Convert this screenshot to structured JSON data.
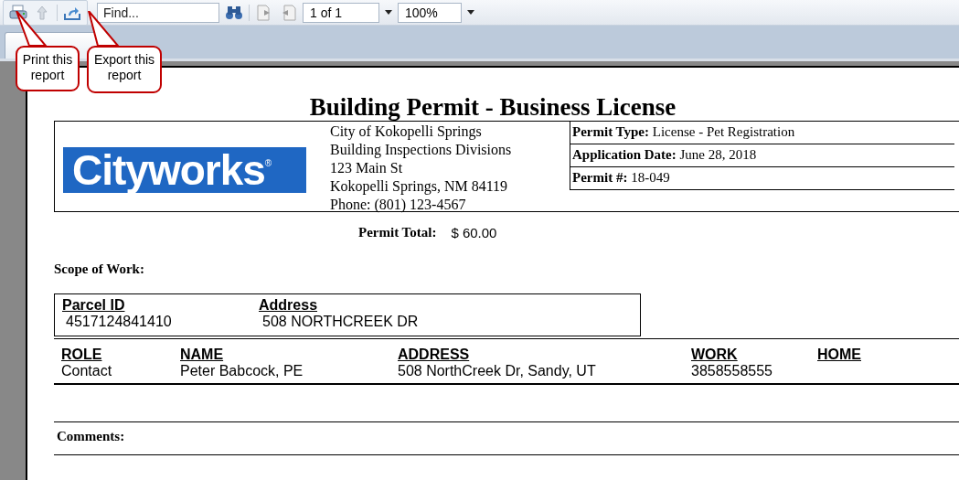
{
  "toolbar": {
    "find": {
      "placeholder": "Find..."
    },
    "page": {
      "value": "1 of 1"
    },
    "zoom": {
      "value": "100%"
    }
  },
  "callouts": [
    "Print this report",
    "Export this report"
  ],
  "report": {
    "title": "Building Permit - Business License",
    "logo": {
      "text": "Cityworks",
      "mark": "®"
    },
    "address": [
      "City of Kokopelli Springs",
      "Building Inspections Divisions",
      "123 Main St",
      "Kokopelli Springs, NM 84119",
      "Phone: (801) 123-4567"
    ],
    "permit_info": [
      {
        "label": "Permit Type:",
        "value": "License - Pet Registration"
      },
      {
        "label": "Application Date:",
        "value": "June 28, 2018"
      },
      {
        "label": "Permit #:",
        "value": "18-049"
      }
    ],
    "permit_total": {
      "label": "Permit Total:",
      "value": "$ 60.00"
    },
    "scope_label": "Scope of Work:",
    "parcels": {
      "columns": [
        "Parcel ID",
        "Address"
      ],
      "rows": [
        [
          "4517124841410",
          "508 NORTHCREEK DR"
        ]
      ]
    },
    "contacts": {
      "columns": [
        "ROLE",
        "NAME",
        "ADDRESS",
        "WORK",
        "HOME"
      ],
      "rows": [
        [
          "Contact",
          "Peter Babcock, PE",
          "508 NorthCreek Dr, Sandy, UT",
          "3858558555",
          ""
        ]
      ]
    },
    "comments_label": "Comments:"
  }
}
